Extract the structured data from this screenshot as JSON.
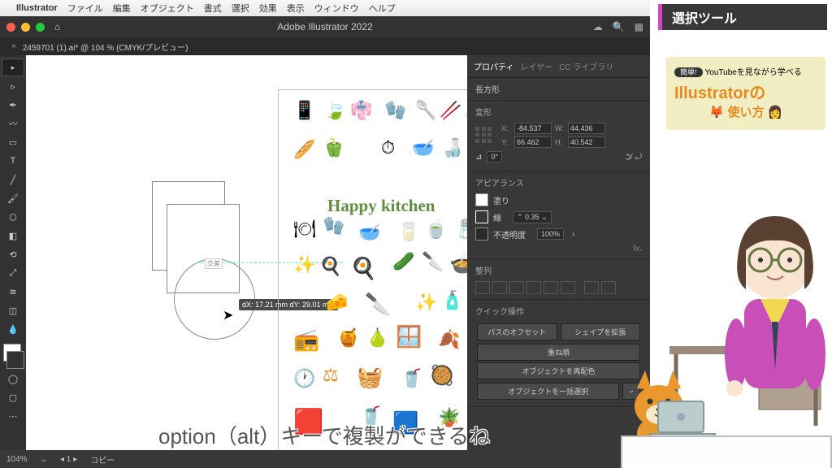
{
  "macmenu": {
    "app": "Illustrator",
    "items": [
      "ファイル",
      "編集",
      "オブジェクト",
      "書式",
      "選択",
      "効果",
      "表示",
      "ウィンドウ",
      "ヘルプ"
    ]
  },
  "titlebar": {
    "title": "Adobe Illustrator 2022",
    "home": "⌂"
  },
  "doctab": {
    "label": "2459701 (1).ai* @ 104 % (CMYK/プレビュー)"
  },
  "canvas": {
    "artboard_title": "Happy kitchen",
    "cursor_tip": "dX: 17.21 mm\ndY: 29.01 mm",
    "intersect": "交差"
  },
  "panel": {
    "tabs": [
      "プロパティ",
      "レイヤー",
      "CC ライブラリ"
    ],
    "shape": "長方形",
    "transform": {
      "title": "変形",
      "x": "-84.537",
      "y": "66.462",
      "w": "44.436",
      "h": "40.542",
      "angle": "0°"
    },
    "appearance": {
      "title": "アピアランス",
      "fill": "塗り",
      "stroke": "線",
      "stroke_val": "0.35",
      "opacity": "不透明度",
      "opacity_val": "100%"
    },
    "align": {
      "title": "整列"
    },
    "quick": {
      "title": "クイック操作",
      "offset": "パスのオフセット",
      "expand": "シェイプを拡張",
      "arrange": "重ね順",
      "recolor": "オブジェクトを再配色",
      "selectall": "オブジェクトを一括選択"
    }
  },
  "statusbar": {
    "zoom": "104%",
    "mode": "コピー"
  },
  "topic": "選択ツール",
  "promo": {
    "badge": "簡単!",
    "line1": "YouTubeを見ながら学べる",
    "title": "Illustratorの",
    "sub": "使い方"
  },
  "caption": "option（alt）キーで複製ができるね"
}
